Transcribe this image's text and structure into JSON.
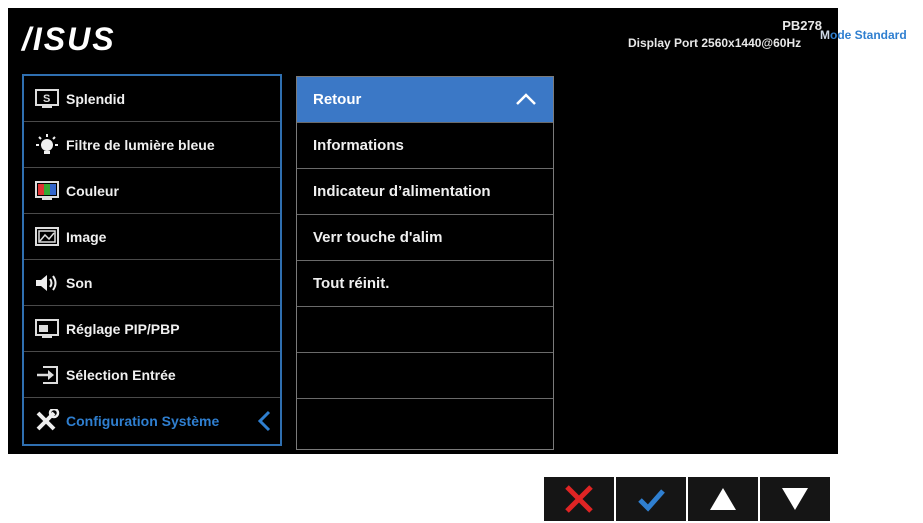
{
  "header": {
    "logo": "ASUS",
    "model": "PB278",
    "port_info": "Display Port  2560x1440@60Hz",
    "mode_prefix": "M",
    "mode_label": "ode Standard"
  },
  "sidebar": {
    "items": [
      {
        "label": "Splendid",
        "icon": "splendid-icon"
      },
      {
        "label": "Filtre de lumière bleue",
        "icon": "bulb-icon"
      },
      {
        "label": "Couleur",
        "icon": "color-icon"
      },
      {
        "label": "Image",
        "icon": "image-icon"
      },
      {
        "label": "Son",
        "icon": "speaker-icon"
      },
      {
        "label": "Réglage PIP/PBP",
        "icon": "pip-icon"
      },
      {
        "label": "Sélection Entrée",
        "icon": "input-icon"
      },
      {
        "label": "Configuration Système",
        "icon": "wrench-icon"
      }
    ],
    "active_index": 7
  },
  "submenu": {
    "items": [
      {
        "label": "Retour"
      },
      {
        "label": "Informations"
      },
      {
        "label": "Indicateur d’alimentation"
      },
      {
        "label": "Verr touche d'alim"
      },
      {
        "label": "Tout réinit."
      },
      {
        "label": ""
      },
      {
        "label": ""
      },
      {
        "label": ""
      }
    ],
    "selected_index": 0
  },
  "controls": [
    {
      "icon": "close-icon",
      "color": "#e02424"
    },
    {
      "icon": "check-icon",
      "color": "#2f7fd0"
    },
    {
      "icon": "arrow-up-icon",
      "color": "#ffffff"
    },
    {
      "icon": "arrow-down-icon",
      "color": "#ffffff"
    }
  ],
  "colors": {
    "accent": "#2f7fd0",
    "selected_bg": "#3b78c6",
    "osd_bg": "#000000"
  }
}
